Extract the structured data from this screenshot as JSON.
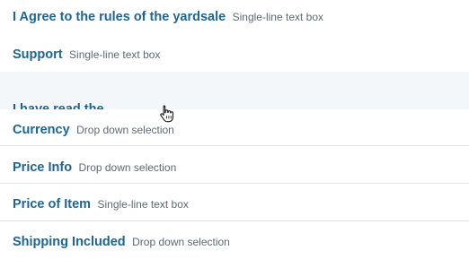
{
  "fields": [
    {
      "name": "I Agree to the rules of the yardsale",
      "type": "Single-line text box"
    },
    {
      "name": "Support",
      "type": "Single-line text box"
    },
    {
      "name": "Currency",
      "type": "Drop down selection"
    },
    {
      "name": "Price Info",
      "type": "Drop down selection"
    },
    {
      "name": "Price of Item",
      "type": "Single-line text box"
    },
    {
      "name": "Shipping Included",
      "type": "Drop down selection"
    }
  ],
  "dragging": {
    "name": "I have read the"
  },
  "cursor": "hand-pointer-icon"
}
